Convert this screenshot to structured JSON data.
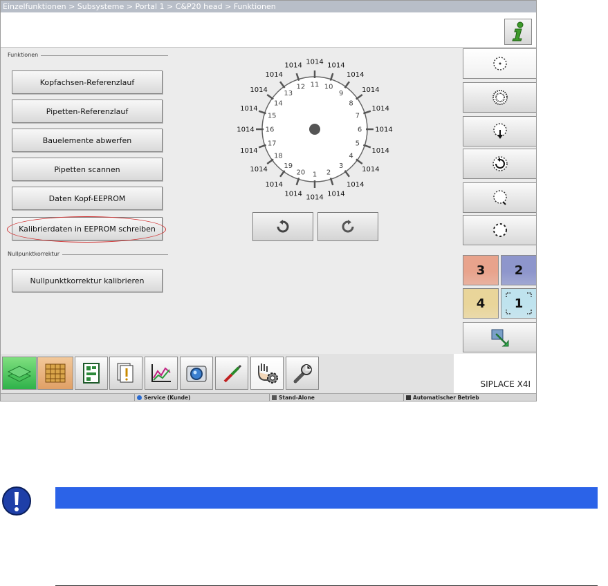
{
  "breadcrumb": "Einzelfunktionen > Subsysteme > Portal 1 > C&P20 head > Funktionen",
  "sections": {
    "functions_label": "Funktionen",
    "zero_label": "Nullpunktkorrektur"
  },
  "buttons": {
    "kopfachsen": "Kopfachsen-Referenzlauf",
    "pipetten_ref": "Pipetten-Referenzlauf",
    "bauelemente": "Bauelemente abwerfen",
    "pipetten_scan": "Pipetten scannen",
    "daten_kopf": "Daten Kopf-EEPROM",
    "kalibrierdaten": "Kalibrierdaten in EEPROM schreiben",
    "nullpunkt": "Nullpunktkorrektur kalibrieren"
  },
  "dial": {
    "segments": [
      {
        "index": "1",
        "value": "1014"
      },
      {
        "index": "2",
        "value": "1014"
      },
      {
        "index": "3",
        "value": "1014"
      },
      {
        "index": "4",
        "value": "1014"
      },
      {
        "index": "5",
        "value": "1014"
      },
      {
        "index": "6",
        "value": "1014"
      },
      {
        "index": "7",
        "value": "1014"
      },
      {
        "index": "8",
        "value": "1014"
      },
      {
        "index": "9",
        "value": "1014"
      },
      {
        "index": "10",
        "value": "1014"
      },
      {
        "index": "11",
        "value": "1014"
      },
      {
        "index": "12",
        "value": "1014"
      },
      {
        "index": "13",
        "value": "1014"
      },
      {
        "index": "14",
        "value": "1014"
      },
      {
        "index": "15",
        "value": "1014"
      },
      {
        "index": "16",
        "value": "1014"
      },
      {
        "index": "17",
        "value": "1014"
      },
      {
        "index": "18",
        "value": "1014"
      },
      {
        "index": "19",
        "value": "1014"
      },
      {
        "index": "20",
        "value": "1014"
      }
    ]
  },
  "portals": [
    {
      "label": "3",
      "color": "#e8a38c"
    },
    {
      "label": "2",
      "color": "#8e96cc"
    },
    {
      "label": "4",
      "color": "#e9d59a"
    },
    {
      "label": "1",
      "color": "#bfe3ee"
    }
  ],
  "machine_name": "SIPLACE X4I",
  "status": {
    "user": "Service (Kunde)",
    "mode": "Stand-Alone",
    "operation": "Automatischer Betrieb"
  },
  "colors": {
    "note_bar": "#2b63e8",
    "highlight": "#d03030"
  }
}
